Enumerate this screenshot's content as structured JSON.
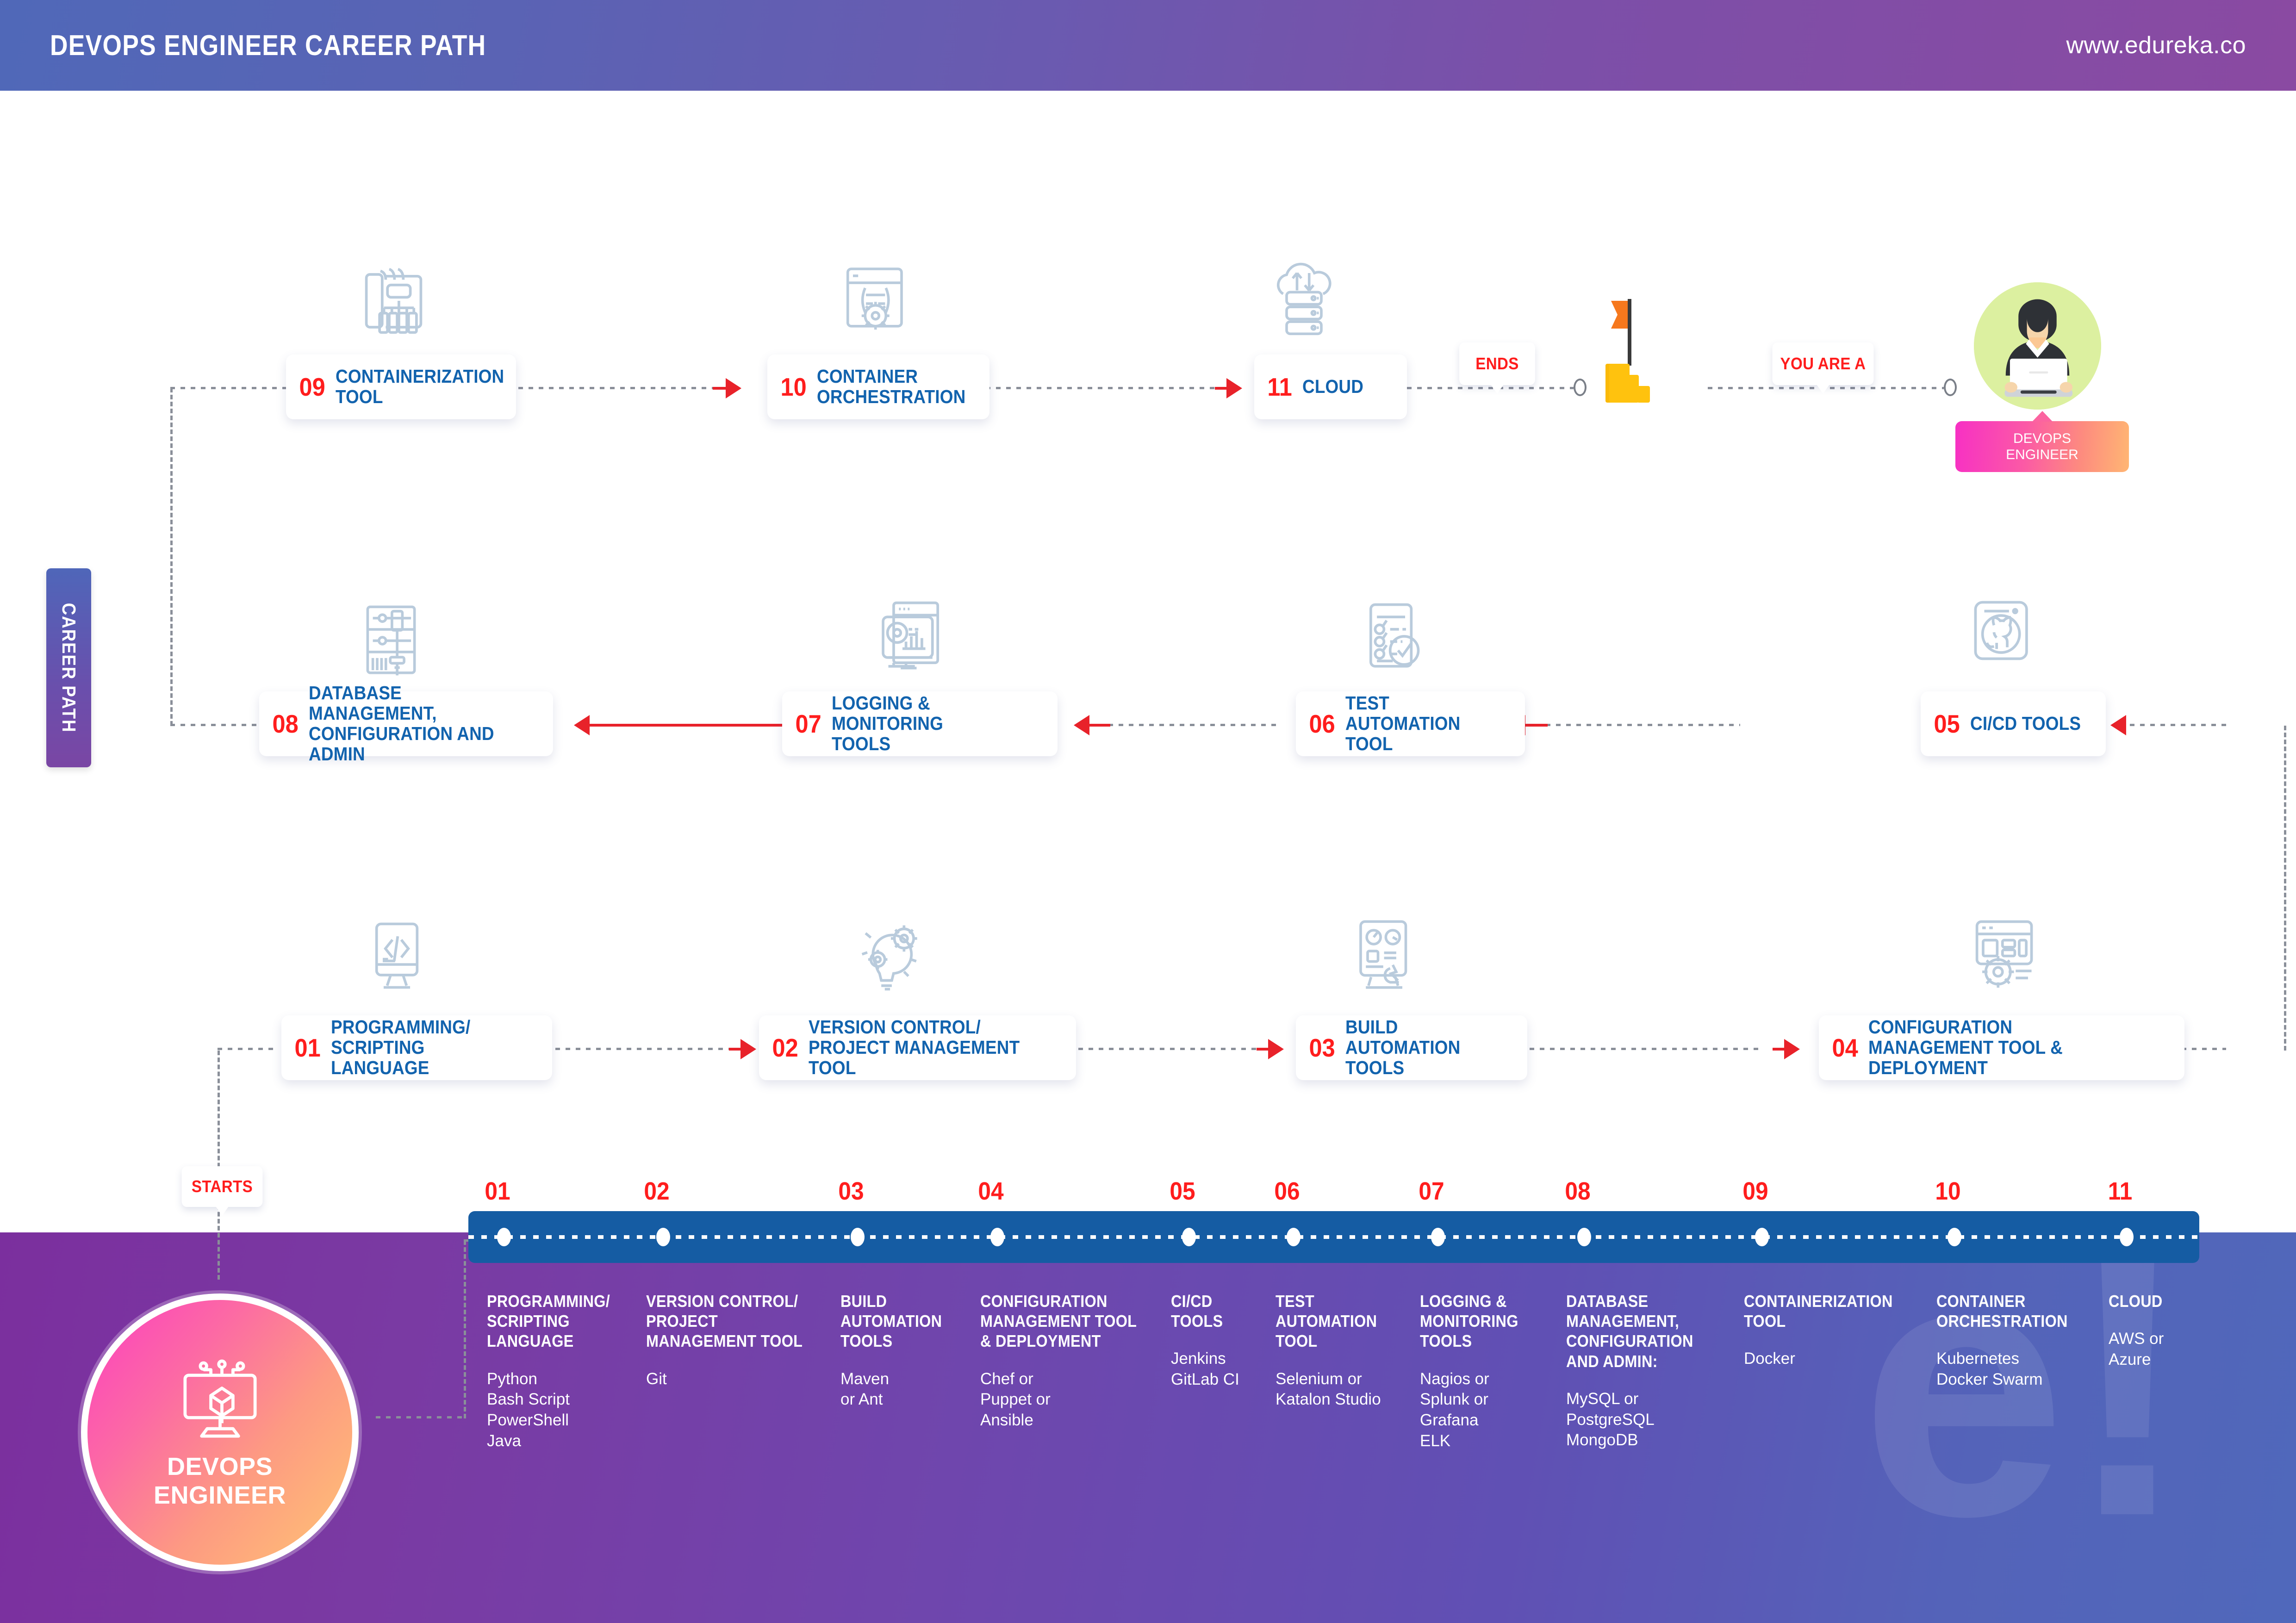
{
  "header": {
    "title": "DEVOPS ENGINEER CAREER PATH",
    "url": "www.edureka.co"
  },
  "side_tab": {
    "label": "CAREER PATH"
  },
  "callouts": {
    "starts": "STARTS",
    "ends": "ENDS",
    "you_are_a": "YOU ARE A"
  },
  "avatar": {
    "badge_line1": "DEVOPS",
    "badge_line2": "ENGINEER"
  },
  "start_node": {
    "line1": "DEVOPS",
    "line2": "ENGINEER"
  },
  "steps": [
    {
      "num": "01",
      "label": "PROGRAMMING/\nSCRIPTING LANGUAGE",
      "icon": "code-monitor-icon"
    },
    {
      "num": "02",
      "label": "VERSION CONTROL/\nPROJECT MANAGEMENT TOOL",
      "icon": "gear-bulb-icon"
    },
    {
      "num": "03",
      "label": "BUILD AUTOMATION\nTOOLS",
      "icon": "build-gauge-icon"
    },
    {
      "num": "04",
      "label": "CONFIGURATION\nMANAGEMENT TOOL & DEPLOYMENT",
      "icon": "config-window-gear-icon"
    },
    {
      "num": "05",
      "label": "CI/CD TOOLS",
      "icon": "github-cat-icon"
    },
    {
      "num": "06",
      "label": "TEST AUTOMATION\nTOOL",
      "icon": "checklist-check-icon"
    },
    {
      "num": "07",
      "label": "LOGGING & MONITORING\nTOOLS",
      "icon": "dashboard-chart-icon"
    },
    {
      "num": "08",
      "label": "DATABASE MANAGEMENT,\nCONFIGURATION AND ADMIN",
      "icon": "slider-panel-icon"
    },
    {
      "num": "09",
      "label": "CONTAINERIZATION\nTOOL",
      "icon": "container-ship-icon"
    },
    {
      "num": "10",
      "label": "CONTAINER\nORCHESTRATION",
      "icon": "window-gear-icon"
    },
    {
      "num": "11",
      "label": "CLOUD",
      "icon": "cloud-server-icon"
    }
  ],
  "timeline": {
    "numbers": [
      "01",
      "02",
      "03",
      "04",
      "05",
      "06",
      "07",
      "08",
      "09",
      "10",
      "11"
    ],
    "columns": [
      {
        "num": "01",
        "title": "PROGRAMMING/\nSCRIPTING\nLANGUAGE",
        "tools": "Python\nBash Script\nPowerShell\nJava"
      },
      {
        "num": "02",
        "title": "VERSION CONTROL/\nPROJECT\nMANAGEMENT TOOL",
        "tools": "Git"
      },
      {
        "num": "03",
        "title": "BUILD\nAUTOMATION\nTOOLS",
        "tools": "Maven\nor Ant"
      },
      {
        "num": "04",
        "title": "CONFIGURATION\nMANAGEMENT TOOL\n& DEPLOYMENT",
        "tools": "Chef or\nPuppet or\nAnsible"
      },
      {
        "num": "05",
        "title": "CI/CD\nTOOLS",
        "tools": "Jenkins\nGitLab CI"
      },
      {
        "num": "06",
        "title": "TEST\nAUTOMATION\nTOOL",
        "tools": "Selenium or\nKatalon Studio"
      },
      {
        "num": "07",
        "title": "LOGGING &\nMONITORING\nTOOLS",
        "tools": "Nagios or\nSplunk or\nGrafana\nELK"
      },
      {
        "num": "08",
        "title": "DATABASE\nMANAGEMENT,\nCONFIGURATION\nAND ADMIN:",
        "tools": "MySQL or\nPostgreSQL\nMongoDB"
      },
      {
        "num": "09",
        "title": "CONTAINERIZATION\nTOOL",
        "tools": "Docker"
      },
      {
        "num": "10",
        "title": "CONTAINER\nORCHESTRATION",
        "tools": "Kubernetes\nDocker Swarm"
      },
      {
        "num": "11",
        "title": "CLOUD",
        "tools": "AWS or\nAzure"
      }
    ]
  },
  "watermark": {
    "logo": "e!"
  },
  "colors": {
    "accent_red": "#ff1d1d",
    "accent_blue": "#1263ae",
    "timeline_blue": "#155ca3",
    "panel_purple": "#7b2f9e",
    "icon_grey": "#b9cbdc"
  }
}
